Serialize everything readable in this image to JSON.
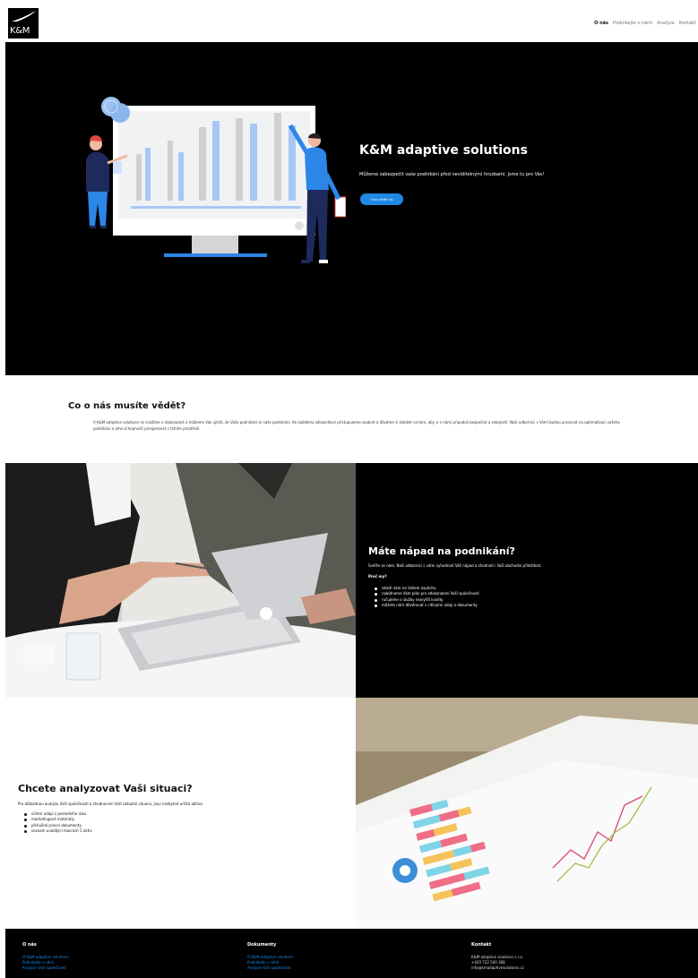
{
  "header": {
    "logo_text": "K&M",
    "nav": [
      "O nás",
      "Podnikejte s námi",
      "Analýza",
      "Kontakt"
    ]
  },
  "hero": {
    "title": "K&M adaptive solutions",
    "subtitle": "Můžeme zabezpečit vaše podnikání před neviditelnými hrozbami. Jsme tu pro Vás!",
    "button": "Chci vědět víc"
  },
  "about": {
    "title": "Co o nás musíte vědět?",
    "text": "V K&M adaptive solutions se snažíme o dokonalost a můžeme Vás ujistit, že Vaše podnikání je naše podnikání. Ke každému zákazníkovi přistupujeme osobně a důváme si záležet na tom, aby si s námi připadali bezpečně a sebejistě. Naši odborníci s Vámi budou pracovat na optimalizaci vašeho podnikání a jeho schopnosti prosperovat v tržním prostředí."
  },
  "idea": {
    "title": "Máte nápad na podnikání?",
    "text": "Svěřte se nám. Naši odborníci s vámi vyhodnotí Váš nápad a zhodnotí i Vaši obchodní příležitost.",
    "why": "Proč my?",
    "items": [
      "záleží nám na Vašem úspěchu",
      "nabídneme Vám plán pro zdokonalení Vaší společnosti",
      "ručujeme o služby nejvyšší kvality",
      "můžete nám důvěrovat s citlivými údaji a dokumenty"
    ]
  },
  "analyze": {
    "title": "Chcete analyzovat Vaši situaci?",
    "text": "Pro důkladnou analýzu Vaší společnosti a zhodnocení Vaší aktuální situace, jsou nezbytné určitá aktiva.",
    "items": [
      "účetní údaje z posledního roku",
      "marketingové materiály",
      "příslušné právní dokumenty",
      "seznam uvádějící hlavních 5 aktiv"
    ]
  },
  "footer": {
    "col1": {
      "title": "O nás",
      "links": [
        "O K&M adaptive solutions",
        "Podnikejte s námi",
        "Analyze Vaší společnosti"
      ]
    },
    "col2": {
      "title": "Dokumenty",
      "links": [
        "O K&M adaptive solutions",
        "Podnikejte s námi",
        "Analyze Vaší společnosti"
      ]
    },
    "col3": {
      "title": "Kontakt",
      "lines": [
        "K&M adaptive solutions s.r.o.",
        "+420 722 500 368",
        "info@kmadaptivesolutions.cz"
      ]
    }
  },
  "colors": {
    "accent": "#1e88e5",
    "dark": "#000000"
  }
}
